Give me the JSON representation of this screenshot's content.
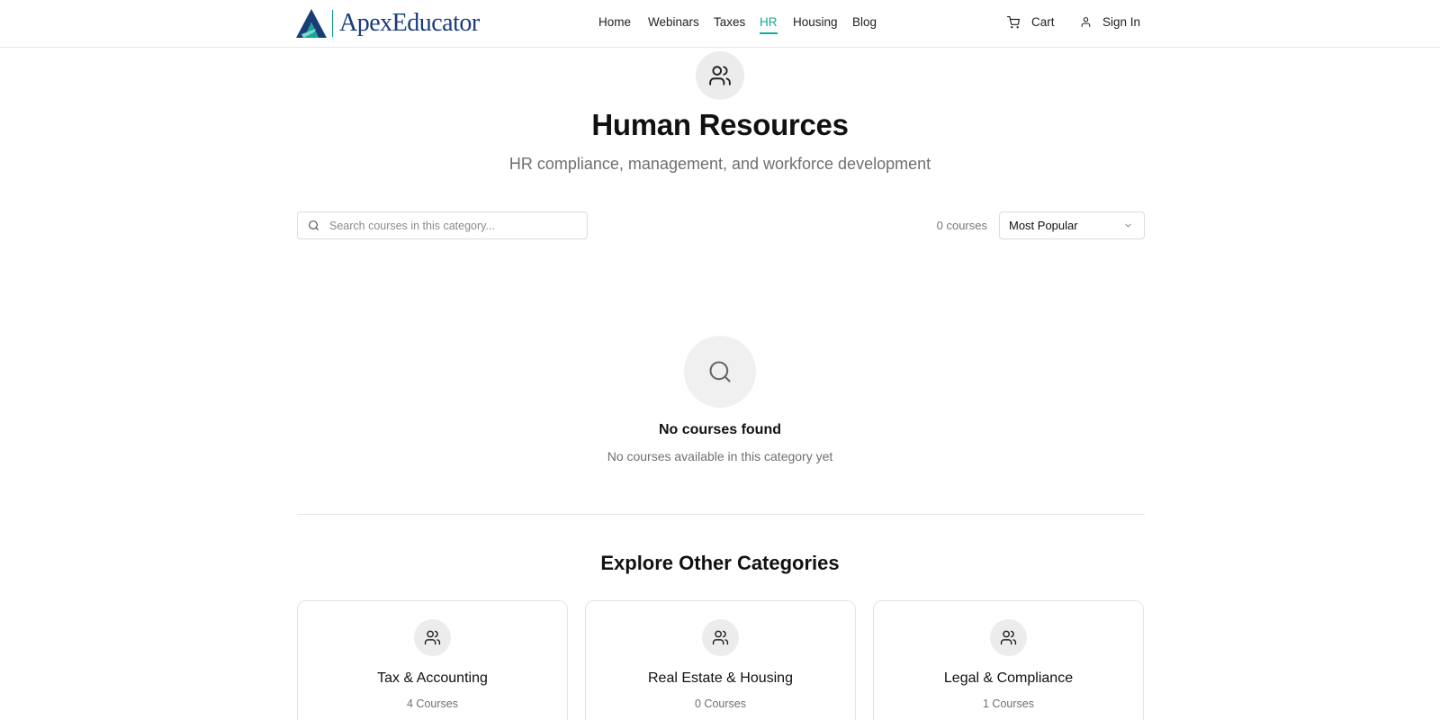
{
  "brand": {
    "name": "ApexEducator",
    "primary_color": "#1a3d78",
    "accent_color": "#14a89a"
  },
  "nav": {
    "items": [
      {
        "label": "Home",
        "active": false
      },
      {
        "label": "Webinars",
        "active": false
      },
      {
        "label": "Taxes",
        "active": false
      },
      {
        "label": "HR",
        "active": true
      },
      {
        "label": "Housing",
        "active": false
      },
      {
        "label": "Blog",
        "active": false
      }
    ],
    "cart_label": "Cart",
    "signin_label": "Sign In"
  },
  "hero": {
    "icon": "users-icon",
    "title": "Human Resources",
    "subtitle": "HR compliance, management, and workforce development"
  },
  "toolbar": {
    "search_placeholder": "Search courses in this category...",
    "search_value": "",
    "course_count": "0 courses",
    "sort_selected": "Most Popular"
  },
  "empty_state": {
    "icon": "search-icon",
    "title": "No courses found",
    "subtitle": "No courses available in this category yet"
  },
  "explore": {
    "title": "Explore Other Categories",
    "categories": [
      {
        "title": "Tax & Accounting",
        "count": "4 Courses",
        "icon": "users-icon"
      },
      {
        "title": "Real Estate & Housing",
        "count": "0 Courses",
        "icon": "users-icon"
      },
      {
        "title": "Legal & Compliance",
        "count": "1 Courses",
        "icon": "users-icon"
      }
    ]
  }
}
